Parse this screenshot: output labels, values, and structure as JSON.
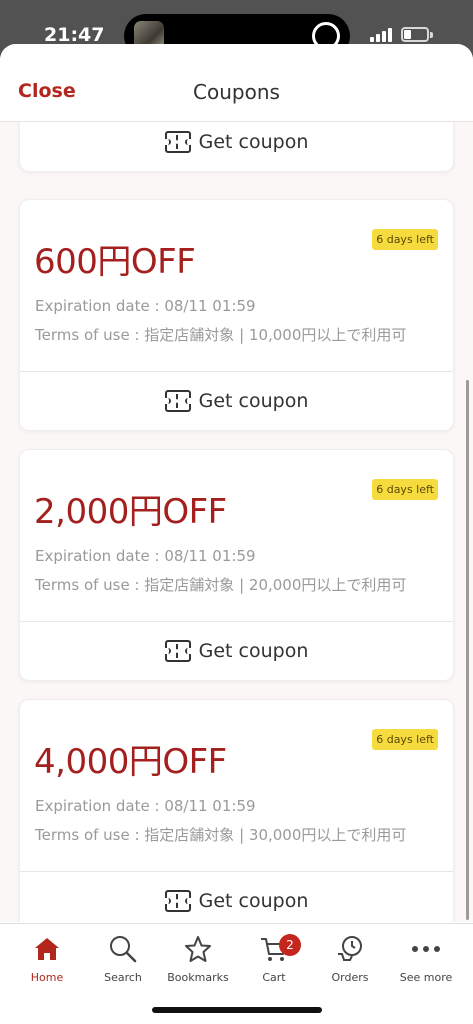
{
  "status": {
    "time": "21:47"
  },
  "header": {
    "close_label": "Close",
    "title": "Coupons"
  },
  "coupons": [
    {
      "get_label": "Get coupon"
    },
    {
      "amount": "600円OFF",
      "badge": "6 days left",
      "expiration": "Expiration date : 08/11 01:59",
      "terms": "Terms of use : 指定店舗対象 | 10,000円以上で利用可",
      "get_label": "Get coupon"
    },
    {
      "amount": "2,000円OFF",
      "badge": "6 days left",
      "expiration": "Expiration date : 08/11 01:59",
      "terms": "Terms of use : 指定店舗対象 | 20,000円以上で利用可",
      "get_label": "Get coupon"
    },
    {
      "amount": "4,000円OFF",
      "badge": "6 days left",
      "expiration": "Expiration date : 08/11 01:59",
      "terms": "Terms of use : 指定店舗対象 | 30,000円以上で利用可",
      "get_label": "Get coupon"
    }
  ],
  "tabbar": {
    "home": "Home",
    "search": "Search",
    "bookmarks": "Bookmarks",
    "cart": "Cart",
    "cart_count": "2",
    "orders": "Orders",
    "see_more": "See more"
  },
  "colors": {
    "accent": "#b3261e",
    "badge": "#f6db3e",
    "price": "#a3201e"
  }
}
